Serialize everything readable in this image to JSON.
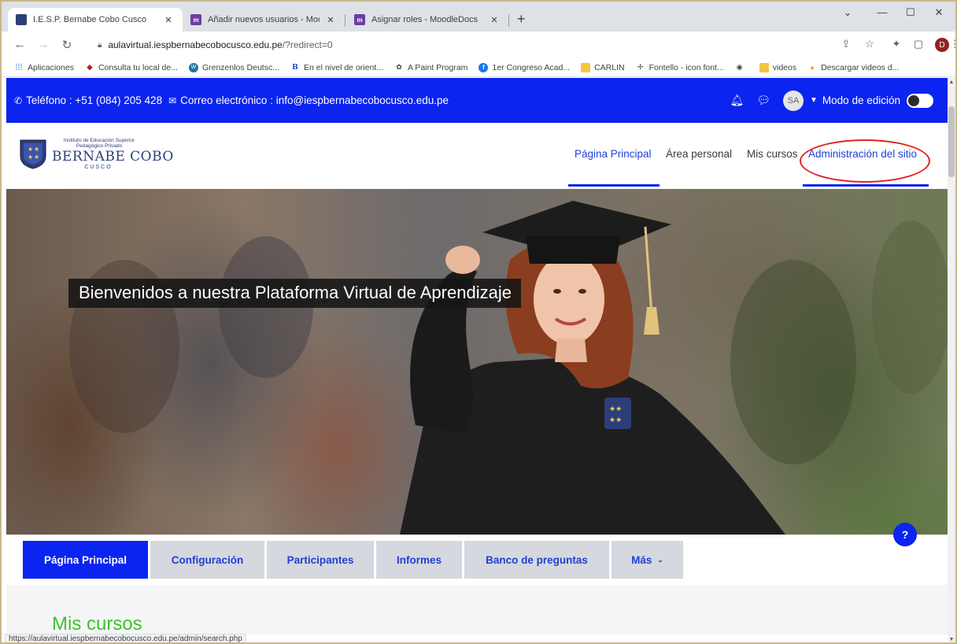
{
  "browser": {
    "tabs": [
      {
        "title": "I.E.S.P. Bernabe Cobo Cusco",
        "favicon": "crest-icon",
        "active": true
      },
      {
        "title": "Añadir nuevos usuarios - Moodle",
        "favicon": "moodle-icon",
        "active": false
      },
      {
        "title": "Asignar roles - MoodleDocs",
        "favicon": "moodle-icon",
        "active": false
      }
    ],
    "moodle_favicon_text": "m",
    "url_host": "aulavirtual.iespbernabecobocusco.edu.pe",
    "url_path": "/?redirect=0",
    "profile_initial": "D",
    "bookmarks": [
      {
        "label": "Aplicaciones",
        "icon": "apps-grid-icon"
      },
      {
        "label": "Consulta tu local de...",
        "icon": "onpe-icon"
      },
      {
        "label": "Grenzenlos Deutsc...",
        "icon": "wordpress-icon"
      },
      {
        "label": "En el nivel de orient...",
        "icon": "b-icon"
      },
      {
        "label": "A Paint Program",
        "icon": "paint-icon"
      },
      {
        "label": "1er Congreso Acad...",
        "icon": "facebook-icon"
      },
      {
        "label": "CARLIN",
        "icon": "folder-icon"
      },
      {
        "label": "Fontello - icon font...",
        "icon": "fontello-icon"
      },
      {
        "label": "",
        "icon": "globe-icon"
      },
      {
        "label": "videos",
        "icon": "folder-icon"
      },
      {
        "label": "Descargar videos d...",
        "icon": "download-icon"
      }
    ],
    "status_url": "https://aulavirtual.iespbernabecobocusco.edu.pe/admin/search.php"
  },
  "site": {
    "contact": {
      "phone": "Teléfono : +51 (084) 205 428",
      "email": "Correo electrónico : info@iespbernabecobocusco.edu.pe"
    },
    "user_initials": "SA",
    "edit_mode_label": "Modo de edición",
    "edit_mode_on": false,
    "logo": {
      "line1": "Instituto de Educación Superior",
      "line2": "Pedagógico Privado",
      "name": "BERNABE COBO",
      "city": "CUSCO"
    },
    "nav": [
      {
        "label": "Página Principal",
        "active": true
      },
      {
        "label": "Área personal",
        "active": false
      },
      {
        "label": "Mis cursos",
        "active": false
      },
      {
        "label": "Administración del sitio",
        "active": false,
        "highlighted": true
      }
    ],
    "hero_title": "Bienvenidos a nuestra Plataforma Virtual de Aprendizaje",
    "secondary_tabs": [
      {
        "label": "Página Principal",
        "active": true
      },
      {
        "label": "Configuración",
        "active": false
      },
      {
        "label": "Participantes",
        "active": false
      },
      {
        "label": "Informes",
        "active": false
      },
      {
        "label": "Banco de preguntas",
        "active": false
      },
      {
        "label": "Más",
        "active": false,
        "dropdown": true
      }
    ],
    "section_heading": "Mis cursos",
    "help_label": "?"
  },
  "colors": {
    "primary": "#0b24f0",
    "heading_green": "#3ec22f",
    "annotation_red": "#e32222"
  }
}
